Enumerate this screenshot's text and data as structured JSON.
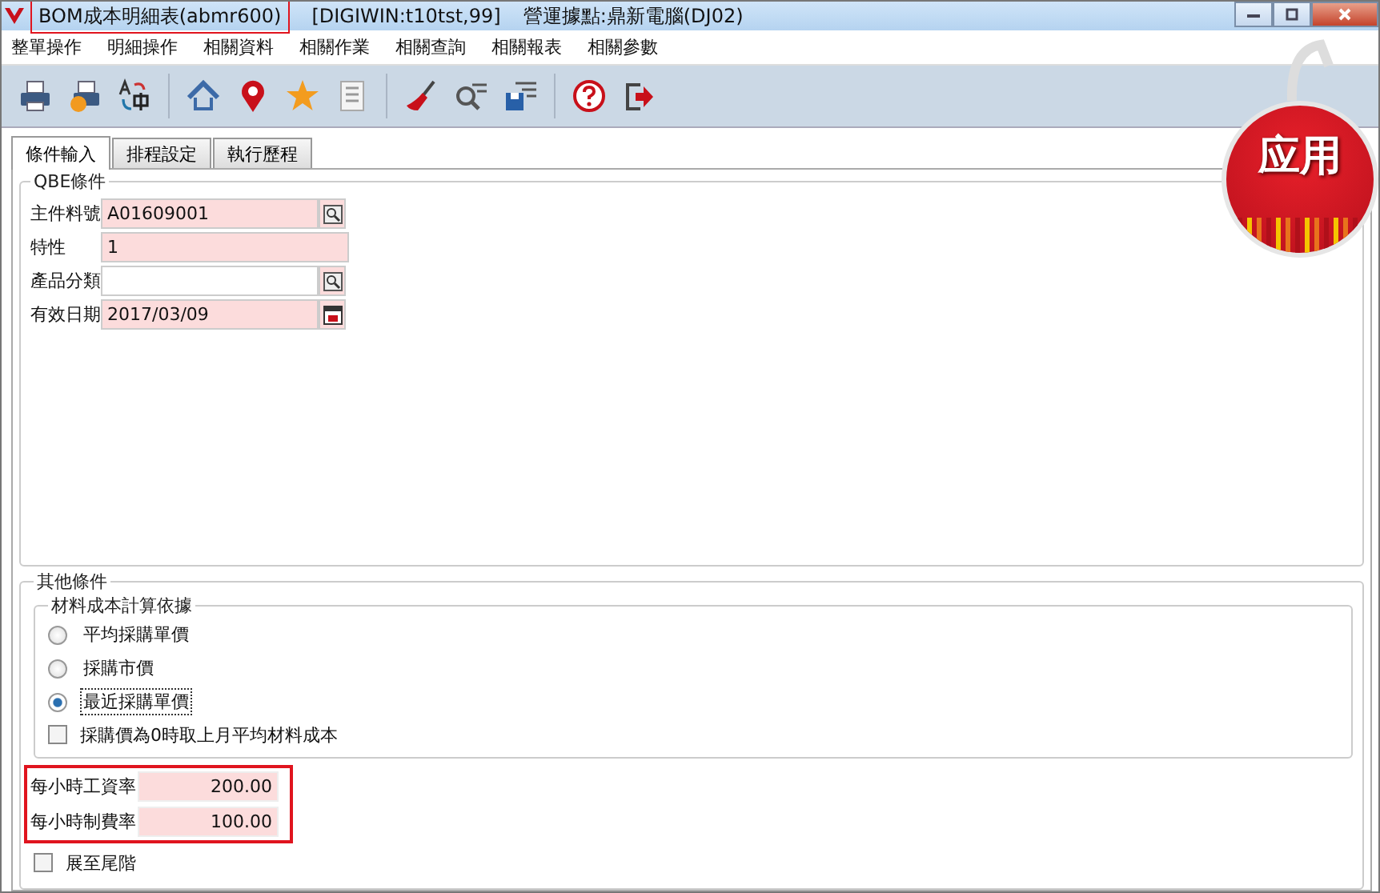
{
  "window": {
    "title": "BOM成本明細表(abmr600)",
    "title_annotated": true,
    "database": "[DIGIWIN:t10tst,99]",
    "site": "營運據點:鼎新電腦(DJ02)"
  },
  "menu": [
    "整單操作",
    "明細操作",
    "相關資料",
    "相關作業",
    "相關查詢",
    "相關報表",
    "相關參數"
  ],
  "tabs": [
    {
      "label": "條件輸入",
      "selected": true
    },
    {
      "label": "排程設定",
      "selected": false
    },
    {
      "label": "執行歷程",
      "selected": false
    }
  ],
  "qbe": {
    "title": "QBE條件",
    "fields": [
      {
        "label": "主件料號",
        "value": "A01609001",
        "required": true,
        "kind": "lookup"
      },
      {
        "label": "特性",
        "value": "1",
        "required": true,
        "kind": "plain"
      },
      {
        "label": "產品分類",
        "required": false,
        "kind": "lookup"
      },
      {
        "label": "有效日期",
        "value": "2017/03/09",
        "required": true,
        "kind": "date"
      }
    ]
  },
  "other": {
    "title": "其他條件",
    "basis": {
      "title": "材料成本計算依據",
      "options": [
        {
          "label": "平均採購單價",
          "selected": false
        },
        {
          "label": "採購市價",
          "selected": false
        },
        {
          "label": "最近採購單價",
          "selected": true
        }
      ],
      "checkbox": {
        "label": "採購價為0時取上月平均材料成本",
        "checked": false
      }
    },
    "rates_annotated": true,
    "rates": [
      {
        "label": "每小時工資率",
        "value": "200.00"
      },
      {
        "label": "每小時制費率",
        "value": "100.00"
      }
    ],
    "checkbox": {
      "label": "展至尾階",
      "checked": false
    }
  },
  "badge": {
    "label": "应用"
  }
}
